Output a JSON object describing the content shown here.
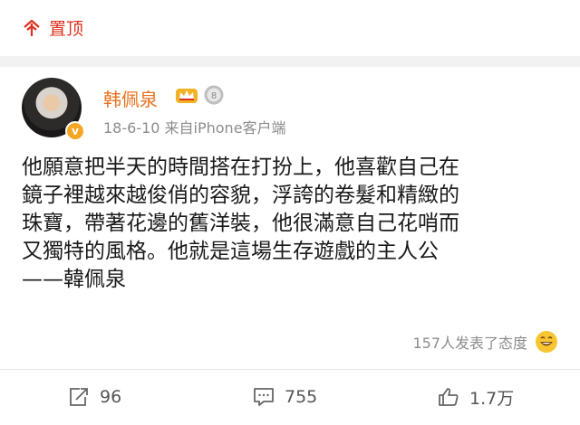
{
  "header": {
    "pin_label": "置顶"
  },
  "post": {
    "username": "韩佩泉",
    "meta": "18-6-10  来自iPhone客户端",
    "content_lines": [
      "他願意把半天的時間搭在打扮上，他喜歡自己在",
      "鏡子裡越來越俊俏的容貌，浮誇的卷髮和精緻的",
      "珠寶，帶著花邊的舊洋裝，他很滿意自己花哨而",
      "又獨特的風格。他就是這場生存遊戲的主人公",
      "——韓佩泉"
    ],
    "attitude_text": "157人发表了态度"
  },
  "actions": {
    "share_count": "96",
    "comment_count": "755",
    "like_count": "1.7万"
  },
  "colors": {
    "accent_red": "#e0301e",
    "username_orange": "#e8711b",
    "meta_gray": "#8c8c8c"
  },
  "icons": [
    "pin-icon",
    "crown-icon",
    "medal-icon",
    "verified-badge",
    "smile-emoji-icon",
    "share-icon",
    "comment-icon",
    "like-icon"
  ]
}
